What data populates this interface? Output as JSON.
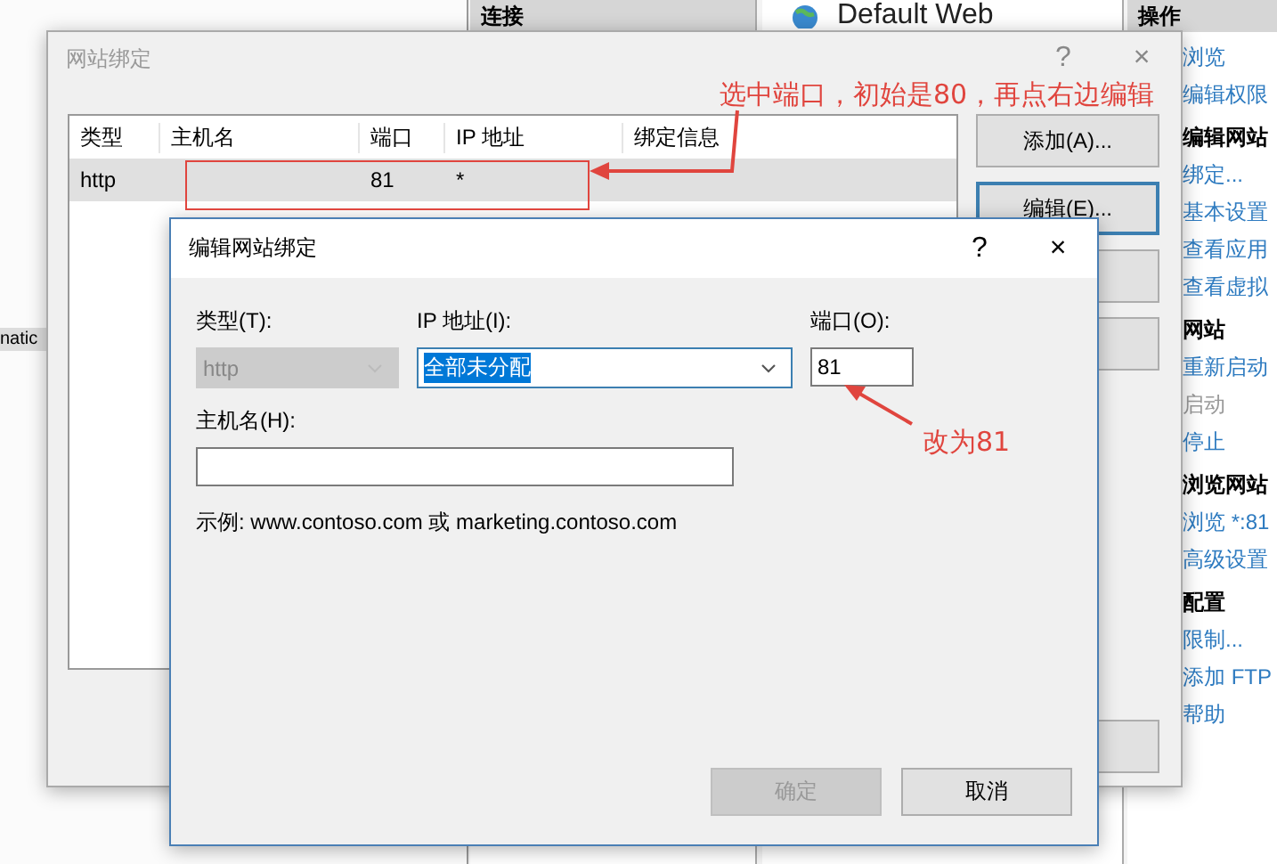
{
  "background": {
    "side_text": "natic",
    "connections_header": "连接",
    "site_title": "Default Web",
    "actions_header": "操作",
    "actions": [
      {
        "kind": "link",
        "label": "浏览",
        "disabled": false
      },
      {
        "kind": "link",
        "label": "编辑权限",
        "disabled": false
      },
      {
        "kind": "header",
        "label": "编辑网站"
      },
      {
        "kind": "link",
        "label": "绑定...",
        "disabled": false
      },
      {
        "kind": "link",
        "label": "基本设置",
        "disabled": false
      },
      {
        "kind": "link",
        "label": "查看应用",
        "disabled": false
      },
      {
        "kind": "link",
        "label": "查看虚拟",
        "disabled": false
      },
      {
        "kind": "header",
        "label": "网站"
      },
      {
        "kind": "link",
        "label": "重新启动",
        "disabled": false
      },
      {
        "kind": "link",
        "label": "启动",
        "disabled": true
      },
      {
        "kind": "link",
        "label": "停止",
        "disabled": false
      },
      {
        "kind": "header",
        "label": "浏览网站"
      },
      {
        "kind": "link",
        "label": "浏览 *:81",
        "disabled": false
      },
      {
        "kind": "link",
        "label": "高级设置",
        "disabled": false
      },
      {
        "kind": "header",
        "label": "配置"
      },
      {
        "kind": "link",
        "label": "限制...",
        "disabled": false
      },
      {
        "kind": "link",
        "label": "添加 FTP",
        "disabled": false
      },
      {
        "kind": "link",
        "label": "帮助",
        "disabled": false
      }
    ]
  },
  "bindings_dialog": {
    "title": "网站绑定",
    "help": "?",
    "close": "×",
    "columns": [
      "类型",
      "主机名",
      "端口",
      "IP 地址",
      "绑定信息"
    ],
    "rows": [
      {
        "type": "http",
        "port": "81",
        "ip": "*",
        "selected": true
      }
    ],
    "buttons": [
      {
        "label": "添加(A)...",
        "focused": false
      },
      {
        "label": "编辑(E)...",
        "focused": true
      }
    ]
  },
  "edit_dialog": {
    "title": "编辑网站绑定",
    "help": "?",
    "close": "×",
    "type_label": "类型(T):",
    "type_value": "http",
    "type_disabled": true,
    "ip_label": "IP 地址(I):",
    "ip_value": "全部未分配",
    "ip_text_selected": true,
    "port_label": "端口(O):",
    "port_value": "81",
    "host_label": "主机名(H):",
    "example": "示例: www.contoso.com 或 marketing.contoso.com",
    "buttons": [
      {
        "label": "确定",
        "disabled": true
      },
      {
        "label": "取消",
        "disabled": false
      }
    ]
  },
  "annotations": [
    {
      "kind": "box"
    },
    {
      "kind": "note",
      "text": "选中端口，初始是80，再点右边编辑"
    },
    {
      "kind": "note",
      "text": "改为81"
    }
  ]
}
